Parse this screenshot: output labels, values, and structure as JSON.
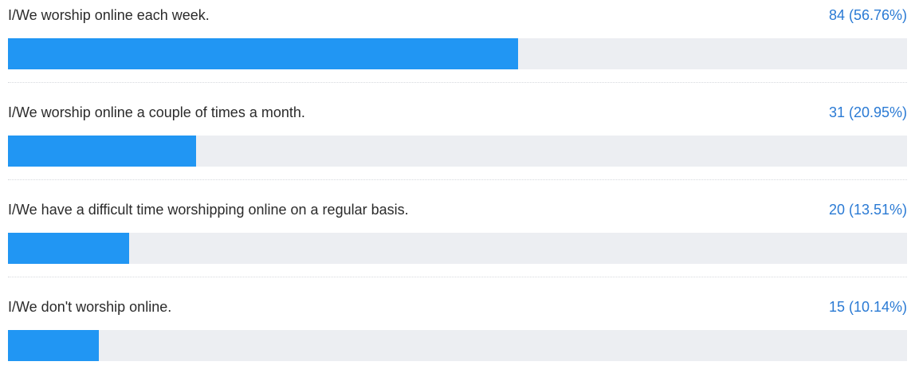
{
  "colors": {
    "bar_fill": "#2196f3",
    "bar_track": "#eceef2",
    "count_text": "#2a7ad4",
    "label_text": "#2b2b2b"
  },
  "chart_data": {
    "type": "bar",
    "orientation": "horizontal",
    "xlim": [
      0,
      100
    ],
    "grid": false,
    "categories": [
      "I/We worship online each week.",
      "I/We worship online a couple of times a month.",
      "I/We have a difficult time worshipping online on a regular basis.",
      "I/We don't worship online."
    ],
    "values": [
      56.76,
      20.95,
      13.51,
      10.14
    ],
    "counts": [
      84,
      31,
      20,
      15
    ],
    "value_labels": [
      "84 (56.76%)",
      "31 (20.95%)",
      "20 (13.51%)",
      "15 (10.14%)"
    ]
  }
}
